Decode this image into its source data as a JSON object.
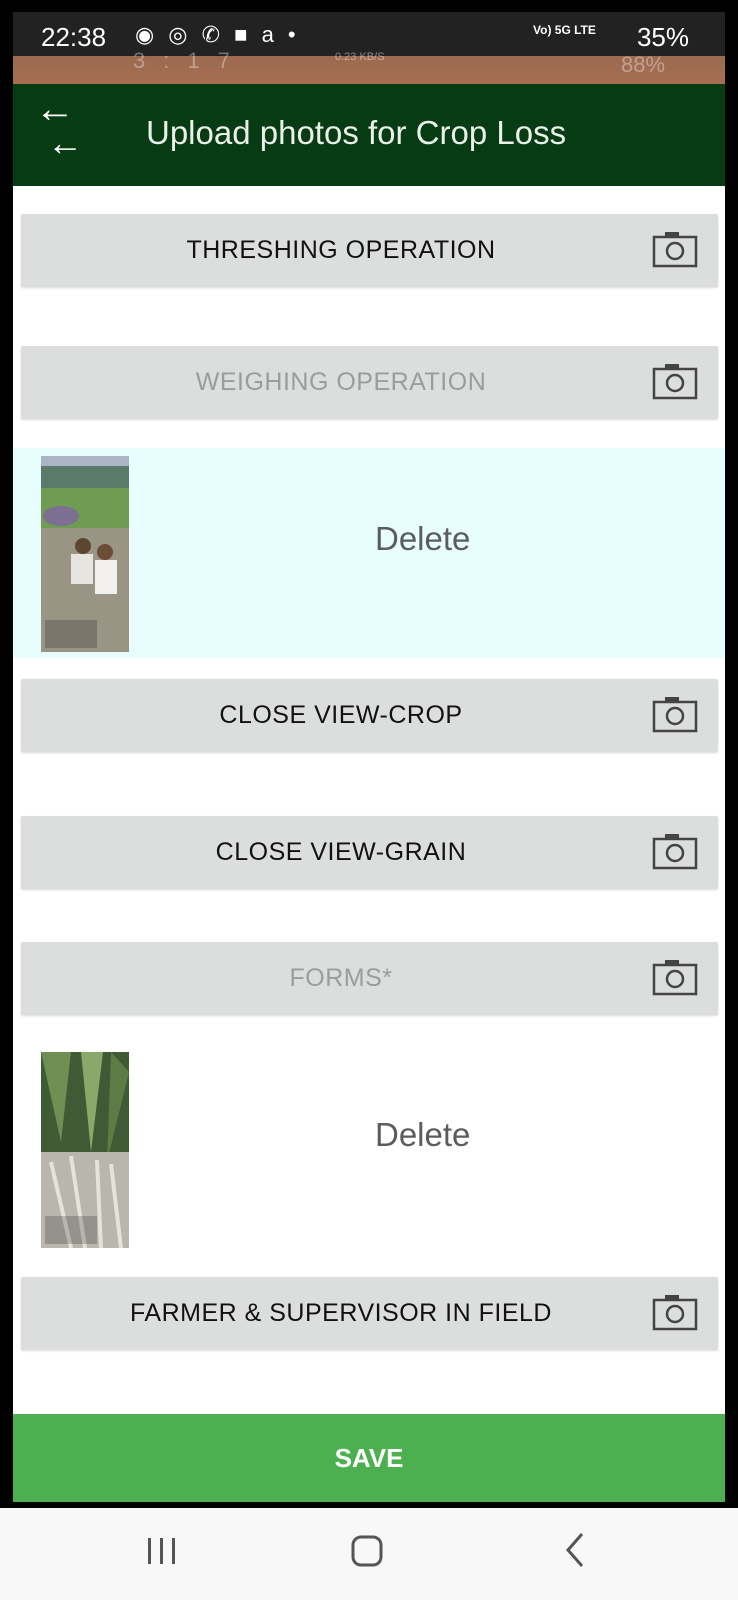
{
  "status_bar": {
    "time": "22:38",
    "left_icons": "◉ ◎ ✆ ■ a •",
    "network": "Vo) 5G LTE",
    "battery": "35%",
    "ghost_left": "3:17",
    "ghost_kb": "0.23 KB/S",
    "ghost_right": "88%"
  },
  "app_bar": {
    "back_icon": "arrow-left-icon",
    "back_glyph": "←",
    "title": "Upload photos for Crop Loss"
  },
  "sections": [
    {
      "label": "THRESHING OPERATION",
      "dim": false,
      "camera_icon": "camera-icon"
    },
    {
      "label": "WEIGHING OPERATION",
      "dim": true,
      "camera_icon": "camera-icon"
    },
    {
      "label": "CLOSE VIEW-CROP",
      "dim": false,
      "camera_icon": "camera-icon"
    },
    {
      "label": "CLOSE VIEW-GRAIN",
      "dim": false,
      "camera_icon": "camera-icon"
    },
    {
      "label": "FORMS*",
      "dim": true,
      "camera_icon": "camera-icon"
    },
    {
      "label": "FARMER & SUPERVISOR IN FIELD",
      "dim": false,
      "camera_icon": "camera-icon"
    }
  ],
  "photos": [
    {
      "delete_label": "Delete",
      "description_icon": "photo-thumbnail"
    },
    {
      "delete_label": "Delete",
      "description_icon": "photo-thumbnail"
    }
  ],
  "save": {
    "label": "SAVE"
  },
  "nav_bar": {
    "recents_icon": "recents-icon",
    "home_icon": "home-icon",
    "back_icon": "back-chevron-icon"
  },
  "colors": {
    "app_bar": "#063b13",
    "section_bg": "#dcdedd",
    "photo_tint": "#e8fdfd",
    "save_green": "#4caf50"
  }
}
